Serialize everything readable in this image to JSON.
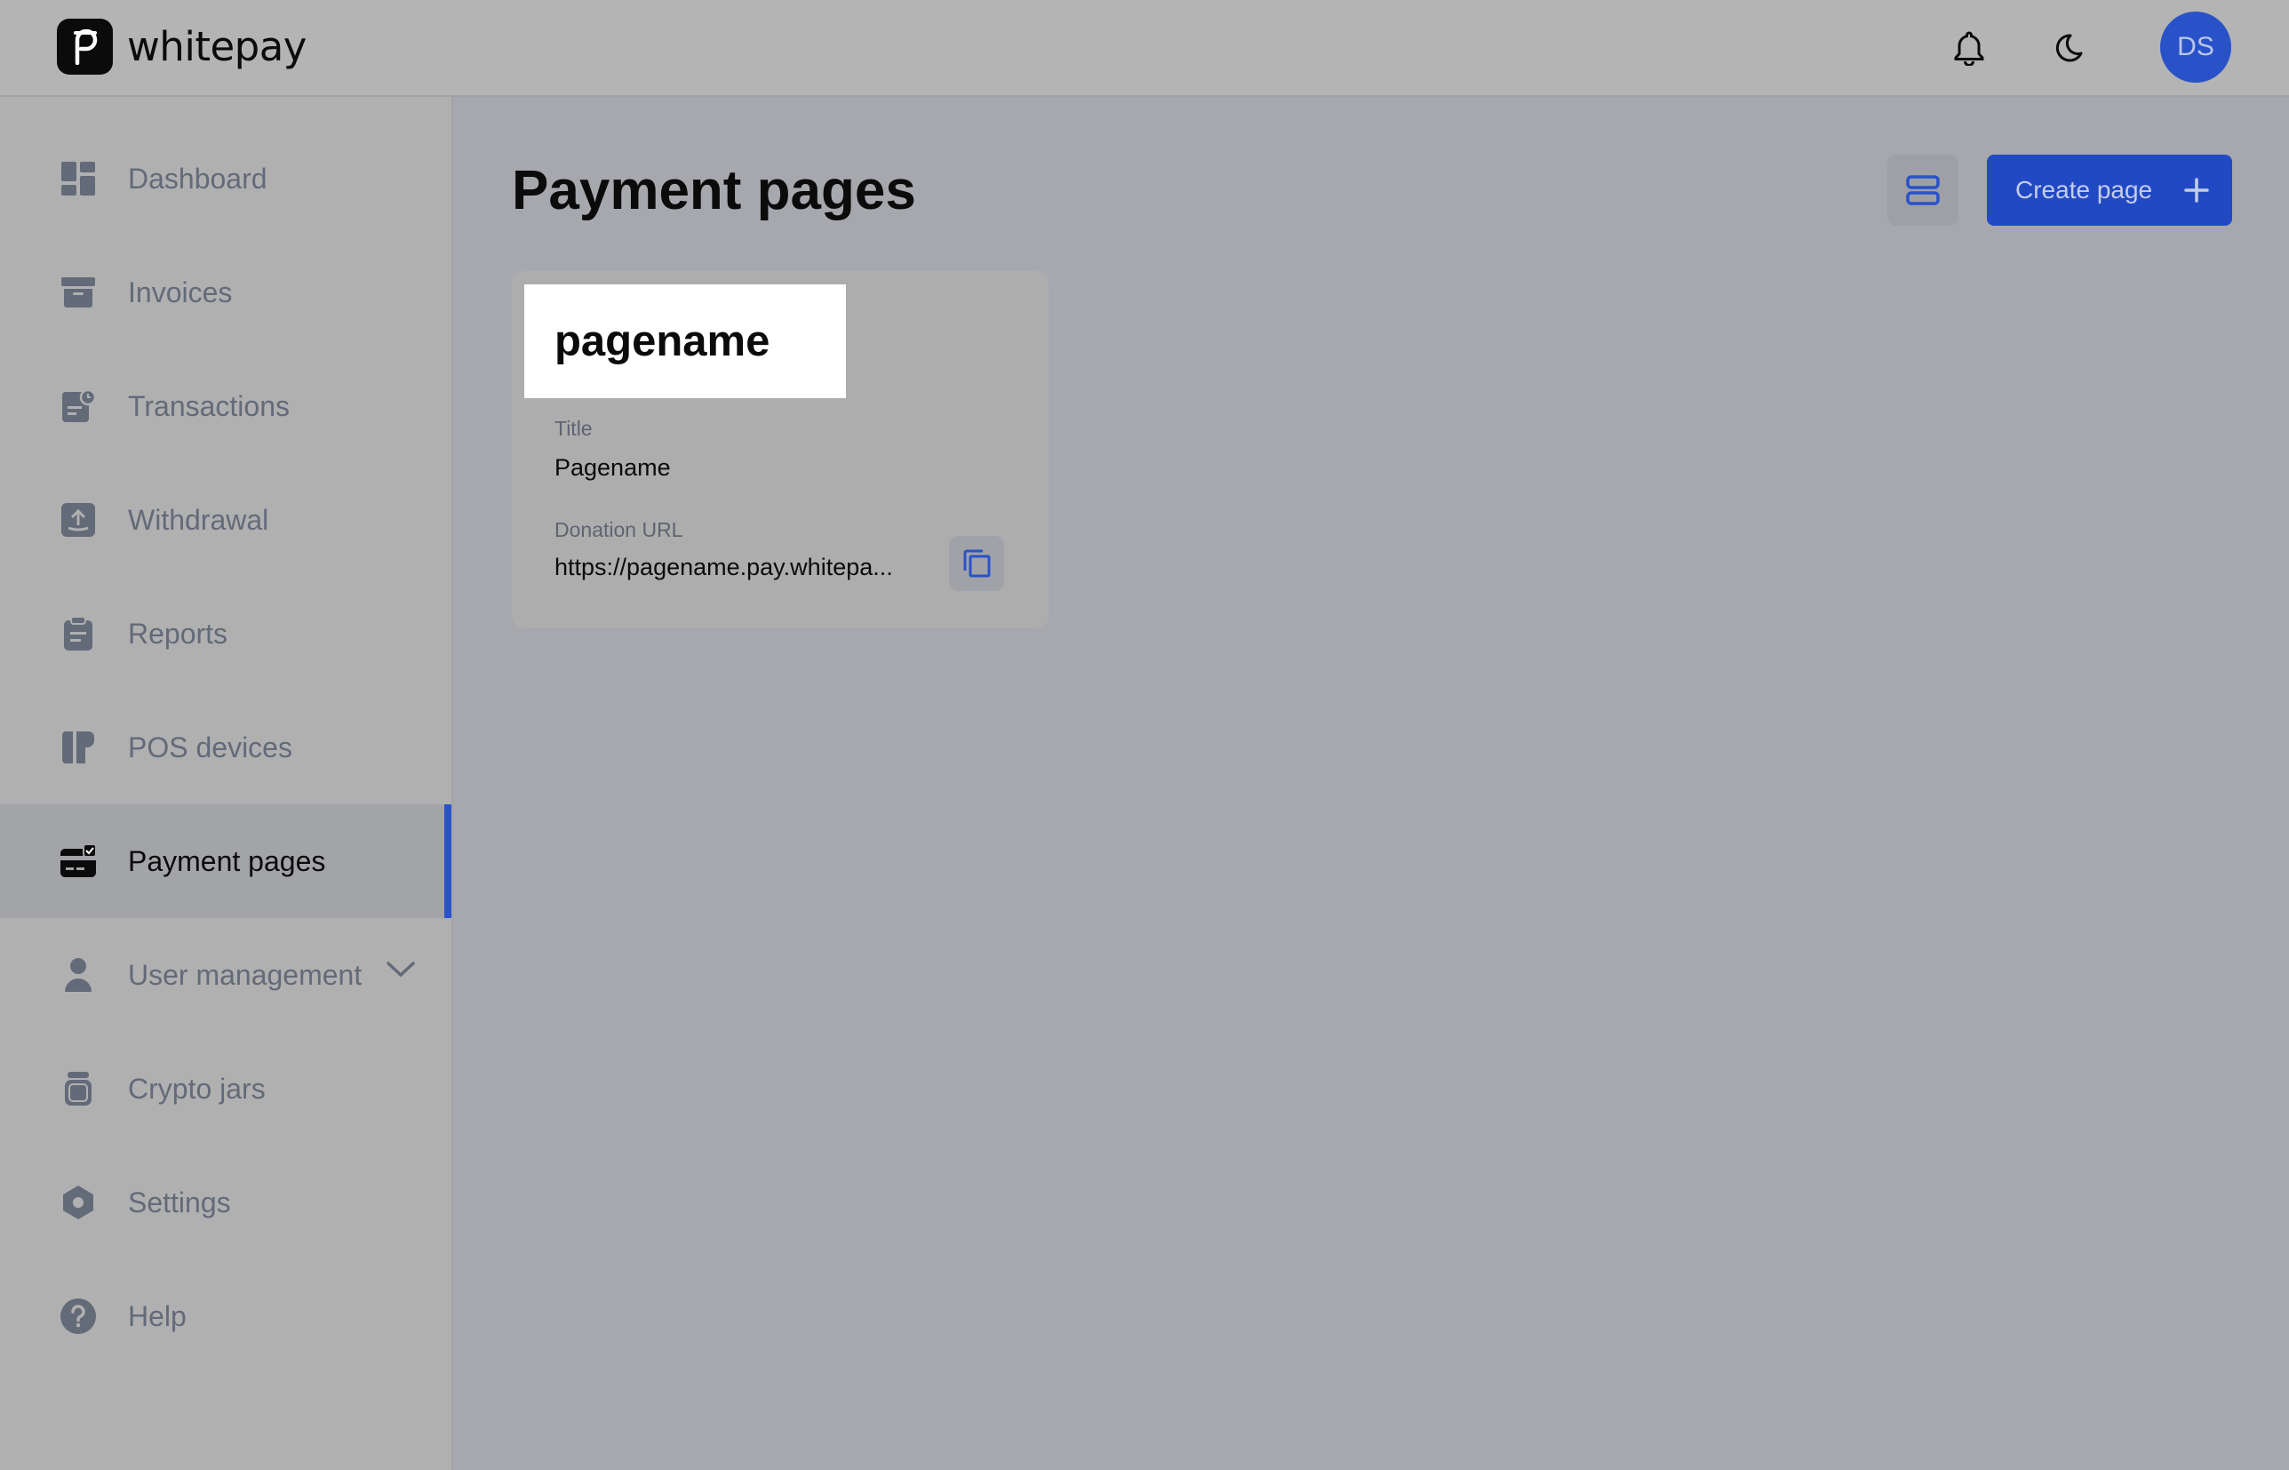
{
  "brand": {
    "name": "whitepay"
  },
  "header": {
    "notifications_icon": "bell-icon",
    "theme_icon": "moon-icon",
    "avatar_initials": "DS"
  },
  "sidebar": {
    "items": [
      {
        "label": "Dashboard",
        "icon": "dashboard-icon"
      },
      {
        "label": "Invoices",
        "icon": "invoice-icon"
      },
      {
        "label": "Transactions",
        "icon": "transactions-icon"
      },
      {
        "label": "Withdrawal",
        "icon": "withdrawal-icon"
      },
      {
        "label": "Reports",
        "icon": "clipboard-icon"
      },
      {
        "label": "POS devices",
        "icon": "pos-device-icon"
      },
      {
        "label": "Payment pages",
        "icon": "payment-card-icon",
        "active": true
      },
      {
        "label": "User management",
        "icon": "user-icon",
        "expandable": true
      },
      {
        "label": "Crypto jars",
        "icon": "jar-icon"
      },
      {
        "label": "Settings",
        "icon": "settings-icon"
      },
      {
        "label": "Help",
        "icon": "help-icon"
      }
    ]
  },
  "main": {
    "title": "Payment pages",
    "create_button_label": "Create page",
    "cards": [
      {
        "banner_text": "pagename",
        "title_label": "Title",
        "title_value": "Pagename",
        "url_label": "Donation URL",
        "url_value": "https://pagename.pay.whitepa..."
      }
    ]
  },
  "colors": {
    "accent": "#2a52c8",
    "overlay_bg": "#a6a8ad",
    "text_dark": "#0b0b0b",
    "text_muted": "#636a78"
  }
}
